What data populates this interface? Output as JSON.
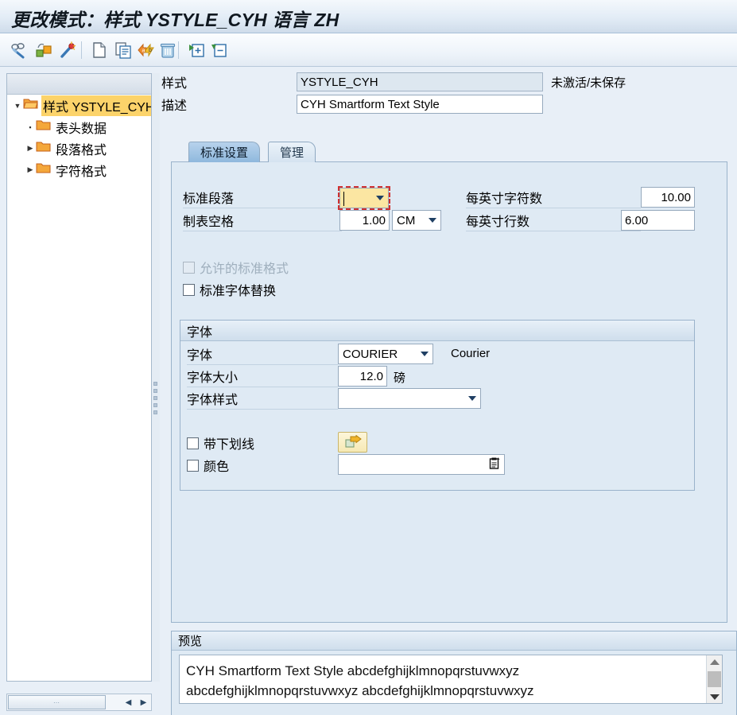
{
  "window": {
    "title": "更改模式：样式 YSTYLE_CYH 语言 ZH"
  },
  "toolbar": {
    "buttons": [
      {
        "name": "display-change-icon",
        "label": "显示 <-> 更改"
      },
      {
        "name": "activate-icon",
        "label": "激活"
      },
      {
        "name": "test-icon",
        "label": "测试"
      },
      {
        "name": "create-icon",
        "label": "创建"
      },
      {
        "name": "copy-icon",
        "label": "复制"
      },
      {
        "name": "rename-icon",
        "label": "重命名"
      },
      {
        "name": "delete-icon",
        "label": "删除"
      },
      {
        "name": "expand-node-icon",
        "label": "展开节点"
      },
      {
        "name": "collapse-node-icon",
        "label": "折叠节点"
      }
    ]
  },
  "tree": {
    "nodes": [
      {
        "label": "样式 YSTYLE_CYH",
        "expander": "▼",
        "selected": true,
        "level": 0
      },
      {
        "label": "表头数据",
        "expander": "▪",
        "selected": false,
        "level": 1
      },
      {
        "label": "段落格式",
        "expander": "▶",
        "selected": false,
        "level": 1
      },
      {
        "label": "字符格式",
        "expander": "▶",
        "selected": false,
        "level": 1
      }
    ],
    "scroll": {
      "grip": "⋯",
      "left_arrow": "◀",
      "right_arrow": "▶"
    }
  },
  "header": {
    "style_label": "样式",
    "style_value": "YSTYLE_CYH",
    "description_label": "描述",
    "description_value": "CYH Smartform Text Style",
    "description_placeholder": "",
    "status": "未激活/未保存"
  },
  "tabs": [
    {
      "label": "标准设置",
      "active": true
    },
    {
      "label": "管理",
      "active": false
    }
  ],
  "standard_settings": {
    "default_paragraph_label": "标准段落",
    "default_paragraph_value": "",
    "tab_spacing_label": "制表空格",
    "tab_spacing_value": "1.00",
    "tab_spacing_unit": "CM",
    "chars_per_inch_label": "每英寸字符数",
    "chars_per_inch_value": "10.00",
    "lines_per_inch_label": "每英寸行数",
    "lines_per_inch_value": "6.00",
    "allow_standard_format_label": "允许的标准格式",
    "allow_standard_format_checked": false,
    "allow_standard_format_disabled": true,
    "standard_font_replace_label": "标准字体替换",
    "standard_font_replace_checked": false
  },
  "font_group": {
    "title": "字体",
    "font_label": "字体",
    "font_value": "COURIER",
    "font_description": "Courier",
    "size_label": "字体大小",
    "size_value": "12.0",
    "size_unit": "磅",
    "style_label": "字体样式",
    "style_value": "",
    "underline_label": "带下划线",
    "underline_checked": false,
    "underline_button_icon": "underline-settings-icon",
    "color_label": "颜色",
    "color_checked": false,
    "color_value": "",
    "color_picker_icon": "value-help-icon"
  },
  "preview": {
    "title": "预览",
    "line1": "CYH Smartform Text Style abcdefghijklmnopqrstuvwxyz",
    "line2": "abcdefghijklmnopqrstuvwxyz abcdefghijklmnopqrstuvwxyz",
    "scroll_up": "▲",
    "scroll_down": "▼"
  },
  "colors": {
    "accent": "#8fb8dd",
    "panel_bg": "#dfeaf4",
    "selection": "#fcd36a",
    "focus_field": "#fbe6a2",
    "focus_outline": "#d03030",
    "readonly_field": "#dde7f0"
  }
}
